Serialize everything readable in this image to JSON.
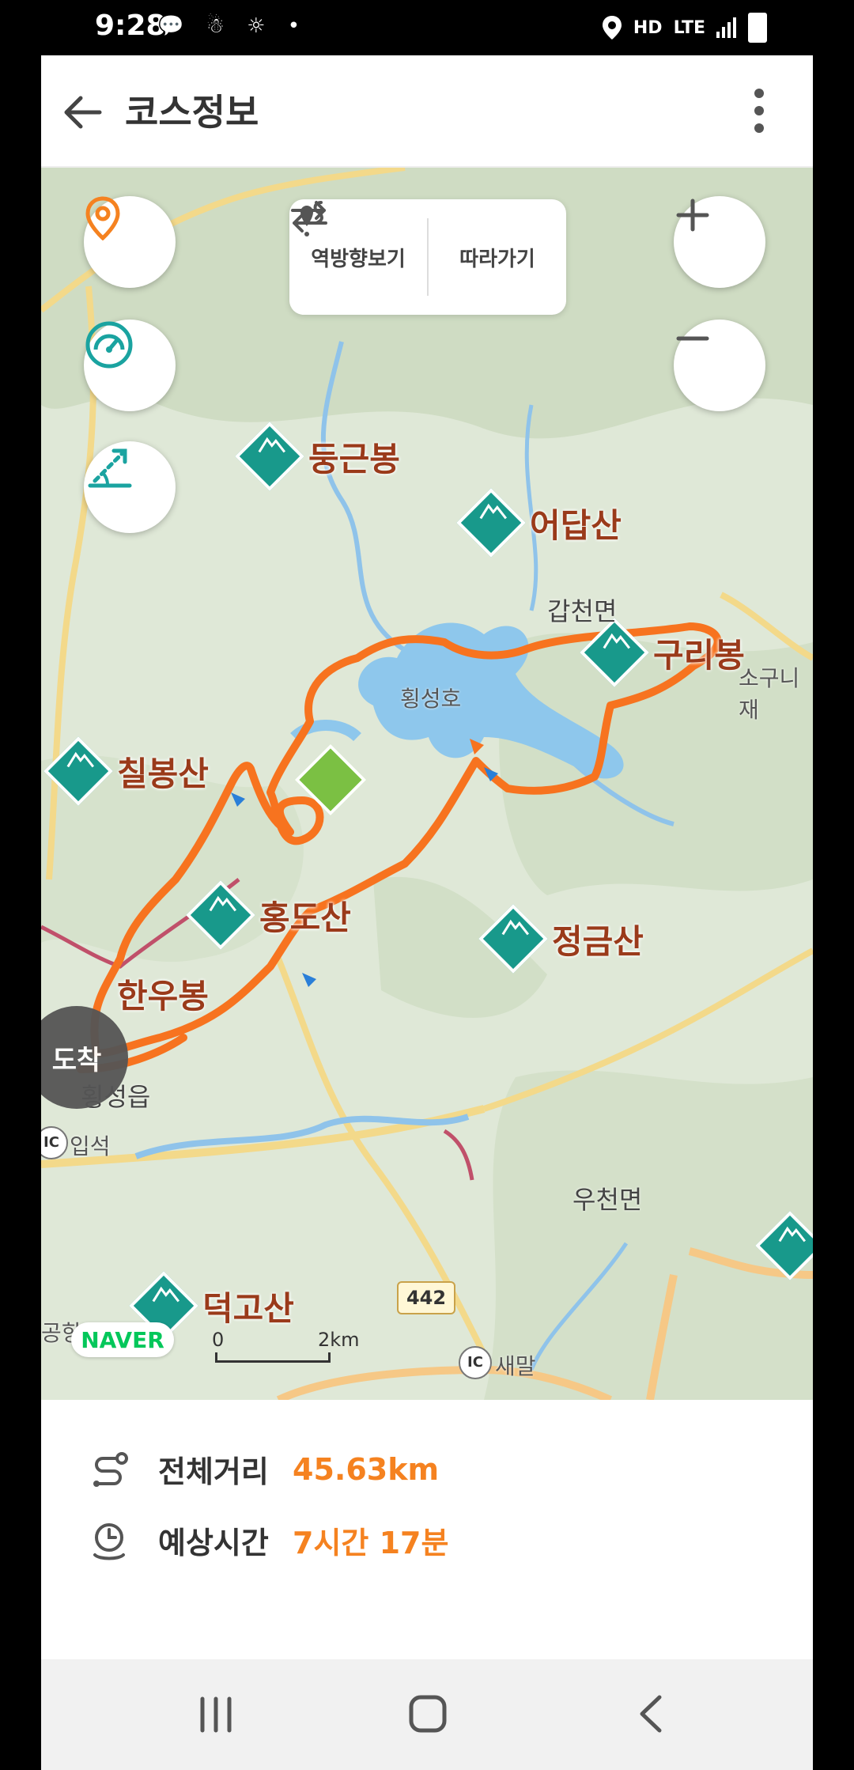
{
  "status": {
    "time": "9:28",
    "left_icons": "💬 ☃ ☼ •",
    "network_hd": "HD",
    "network_lte": "LTE",
    "network_voice": "voice"
  },
  "header": {
    "title": "코스정보"
  },
  "map": {
    "toggle": {
      "reverse_label": "역방향보기",
      "follow_label": "따라가기"
    },
    "peaks": [
      {
        "name": "둥근봉"
      },
      {
        "name": "어답산"
      },
      {
        "name": "구리봉"
      },
      {
        "name": "칠봉산"
      },
      {
        "name": "홍도산"
      },
      {
        "name": "정금산"
      },
      {
        "name": "한우봉"
      },
      {
        "name": "덕고산"
      }
    ],
    "places": {
      "lake": "횡성호",
      "ganhyeon": "갑천면",
      "sogu": "소구니재",
      "hoengseong": "횡성읍",
      "ipseok": "입석",
      "ucheon": "우천면",
      "saemal": "새말",
      "airport": "공항"
    },
    "road_number": "442",
    "ic_label": "IC",
    "arrival_label": "도착",
    "naver_logo": "NAVER",
    "scale": {
      "zero": "0",
      "max": "2km"
    }
  },
  "info": {
    "distance_label": "전체거리",
    "distance_value": "45.63km",
    "time_label": "예상시간",
    "time_value": "7시간 17분"
  },
  "colors": {
    "accent": "#f58220",
    "peak": "#18998b",
    "route": "#f7731f"
  }
}
